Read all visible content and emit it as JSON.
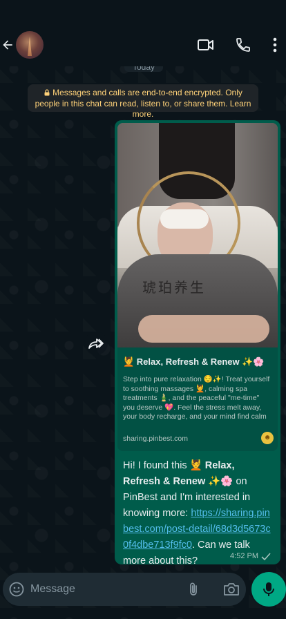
{
  "header": {
    "back_icon": "arrow-left-icon",
    "avatar_icon": "contact-avatar",
    "video_icon": "video-camera-icon",
    "call_icon": "phone-icon",
    "menu_icon": "more-vert-icon"
  },
  "chat": {
    "date_chip": "Today",
    "encryption_notice": "Messages and calls are end-to-end encrypted. Only people in this chat can read, listen to, or share them. Learn more."
  },
  "message": {
    "link_preview": {
      "blanket_text": "琥珀养生",
      "title": "💆 Relax, Refresh & Renew ✨🌸",
      "description": "Step into pure relaxation 😌✨! Treat yourself to soothing massages 💆, calming spa treatments 🎍, and the peaceful \"me-time\" you deserve 💖. Feel the stress melt away, your body recharge, and your mind find calm 🕊️. Every visit is a little esc...",
      "domain": "sharing.pinbest.com"
    },
    "text_intro": "Hi! I found this 💆 ",
    "text_bold": "Relax, Refresh & Renew",
    "text_emoji": " ✨🌸 ",
    "text_mid": "on PinBest and I'm interested in knowing more: ",
    "link": "https://sharing.pinbest.com/post-detail/68d3d5673c0f4dbe713f9fc0",
    "text_end": ". Can we talk more about this?",
    "time": "4:52 PM",
    "status_icon": "check-icon"
  },
  "composer": {
    "placeholder": "Message",
    "emoji_icon": "emoji-icon",
    "attach_icon": "paperclip-icon",
    "camera_icon": "camera-icon",
    "mic_icon": "microphone-icon"
  },
  "colors": {
    "bubble": "#005c4b",
    "accent": "#00a884",
    "link": "#53bdeb",
    "notice": "#ffd279"
  }
}
